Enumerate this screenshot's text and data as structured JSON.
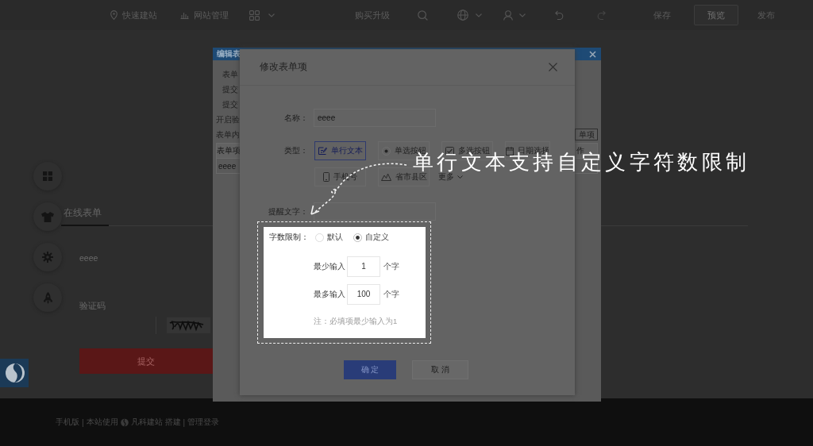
{
  "top_bar": {
    "site_build": "快速建站",
    "site_manage": "网站管理",
    "upgrade": "购买升级",
    "save": "保存",
    "preview": "预览",
    "publish": "发布"
  },
  "page": {
    "tabs": [
      {
        "label": "在线表单",
        "selected": true
      }
    ],
    "fields": [
      {
        "kind": "text",
        "label": "eeee"
      },
      {
        "kind": "captcha",
        "label": "验证码"
      }
    ],
    "submit": "提交"
  },
  "footer": {
    "items": [
      {
        "kind": "link",
        "text": "手机版"
      },
      {
        "kind": "separator",
        "text": "|"
      },
      {
        "kind": "text",
        "text": "本站使用"
      },
      {
        "kind": "logo"
      },
      {
        "kind": "link",
        "text": "凡科建站"
      },
      {
        "kind": "text",
        "text": "搭建"
      },
      {
        "kind": "separator",
        "text": "|"
      },
      {
        "kind": "link",
        "text": "管理登录"
      }
    ]
  },
  "edit_form_dialog": {
    "title": "编辑表",
    "fields": [
      "表单",
      "提交",
      "提交"
    ],
    "sections": [
      "开启验",
      "表单内"
    ],
    "add_button": "单项",
    "table": {
      "header": "表单项",
      "column_2": "作",
      "cell": "eeee"
    }
  },
  "dialog": {
    "title": "修改表单项",
    "name": {
      "label": "名称：",
      "value": "eeee"
    },
    "type": {
      "label": "类型：",
      "options": [
        {
          "kind": "text",
          "label": "单行文本",
          "selected": true
        },
        {
          "kind": "radio",
          "label": "单选按钮",
          "selected": false
        },
        {
          "kind": "checkbox",
          "label": "多选按钮",
          "selected": false
        },
        {
          "kind": "date",
          "label": "日期选择",
          "selected": false
        },
        {
          "kind": "phone",
          "label": "手机号",
          "selected": false
        },
        {
          "kind": "region",
          "label": "省市县区",
          "selected": false
        }
      ],
      "more": "更多"
    },
    "hint": {
      "label": "提醒文字："
    },
    "limit": {
      "label": "字数限制：",
      "options": [
        {
          "label": "默认",
          "selected": false
        },
        {
          "label": "自定义",
          "selected": true
        }
      ],
      "ranges": [
        {
          "label": "最少输入",
          "value": "1",
          "unit": "个字"
        },
        {
          "label": "最多输入",
          "value": "100",
          "unit": "个字"
        }
      ],
      "note": "注：必填项最少输入为1"
    },
    "buttons": [
      {
        "kind": "primary",
        "label": "确 定"
      },
      {
        "kind": "secondary",
        "label": "取 消"
      }
    ]
  },
  "callout": "单行文本支持自定义字符数限制"
}
